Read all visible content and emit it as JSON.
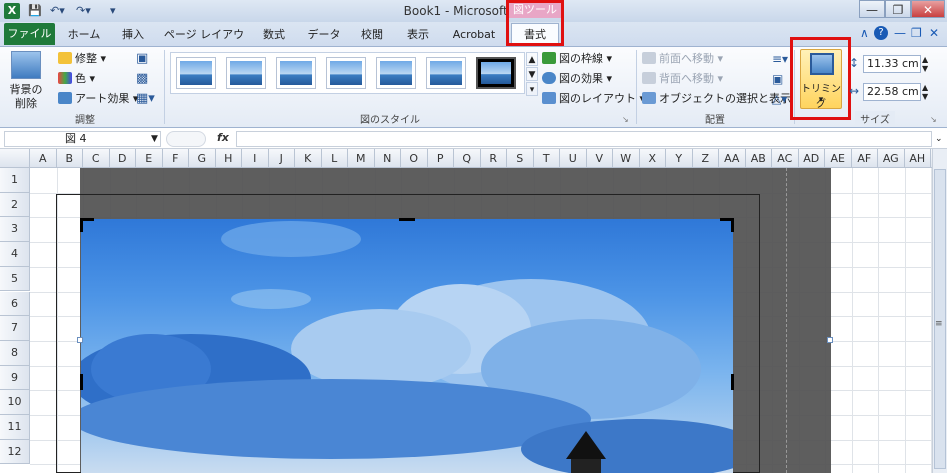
{
  "window": {
    "title": "Book1 - Microsoft Excel",
    "app_icon": "X"
  },
  "context_tab_group": "図ツール",
  "tabs": [
    {
      "label": "ファイル"
    },
    {
      "label": "ホーム"
    },
    {
      "label": "挿入"
    },
    {
      "label": "ページ レイアウト"
    },
    {
      "label": "数式"
    },
    {
      "label": "データ"
    },
    {
      "label": "校閲"
    },
    {
      "label": "表示"
    },
    {
      "label": "Acrobat"
    },
    {
      "label": "書式"
    }
  ],
  "ribbon": {
    "adjust": {
      "remove_bg": "背景の\n削除",
      "corrections": "修整",
      "color": "色",
      "artistic": "アート効果",
      "group_label": "調整"
    },
    "styles": {
      "group_label": "図のスタイル"
    },
    "picture_options": {
      "border": "図の枠線",
      "effects": "図の効果",
      "layout": "図のレイアウト"
    },
    "arrange": {
      "bring_forward": "前面へ移動",
      "send_backward": "背面へ移動",
      "selection_pane": "オブジェクトの選択と表示",
      "group_label": "配置"
    },
    "size": {
      "crop": "トリミング",
      "height": "11.33 cm",
      "width": "22.58 cm",
      "group_label": "サイズ"
    }
  },
  "formula_bar": {
    "name_box": "図 4",
    "fx": "fx",
    "content": ""
  },
  "columns": [
    "A",
    "B",
    "C",
    "D",
    "E",
    "F",
    "G",
    "H",
    "I",
    "J",
    "K",
    "L",
    "M",
    "N",
    "O",
    "P",
    "Q",
    "R",
    "S",
    "T",
    "U",
    "V",
    "W",
    "X",
    "Y",
    "Z",
    "AA",
    "AB",
    "AC",
    "AD",
    "AE",
    "AF",
    "AG",
    "AH",
    "AI"
  ],
  "rows": [
    "1",
    "2",
    "3",
    "4",
    "5",
    "6",
    "7",
    "8",
    "9",
    "10",
    "11",
    "12"
  ],
  "colors": {
    "accent_red": "#e01010",
    "file_tab": "#1f7a3a",
    "context_pink": "#e8a6c6"
  }
}
